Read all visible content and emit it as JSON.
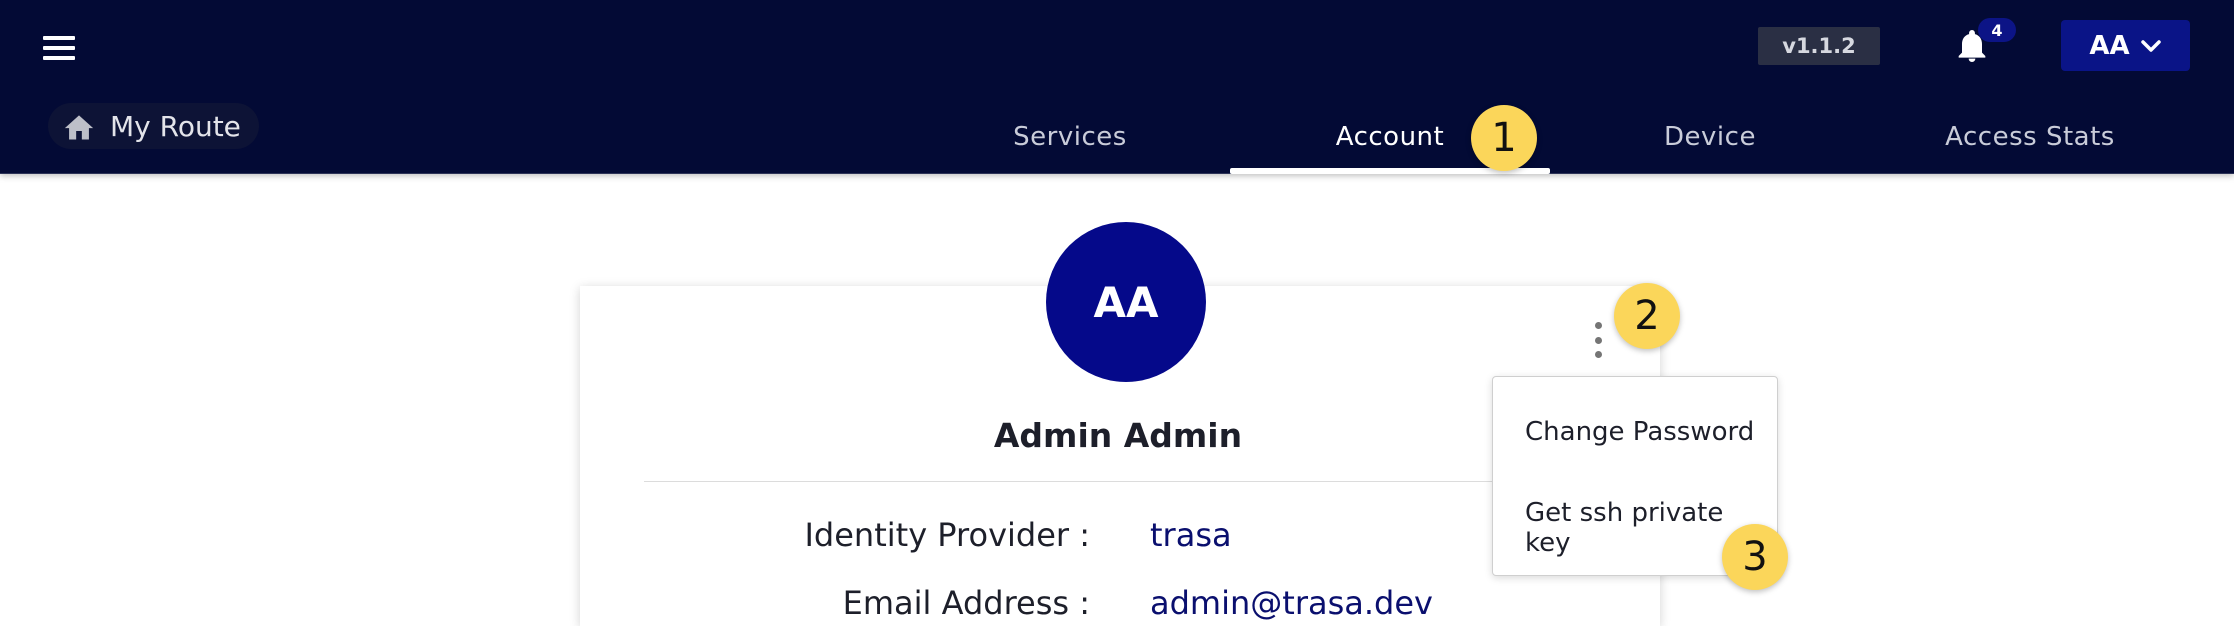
{
  "header": {
    "version": "v1.1.2",
    "notification_count": "4",
    "user_initials": "AA",
    "breadcrumb_label": "My Route"
  },
  "tabs": [
    {
      "label": "Services",
      "active": false
    },
    {
      "label": "Account",
      "active": true
    },
    {
      "label": "Device",
      "active": false
    },
    {
      "label": "Access Stats",
      "active": false
    }
  ],
  "steps": [
    "1",
    "2",
    "3"
  ],
  "profile": {
    "initials": "AA",
    "name": "Admin Admin",
    "fields": [
      {
        "label": "Identity Provider :",
        "value": "trasa"
      },
      {
        "label": "Email Address :",
        "value": "admin@trasa.dev"
      }
    ]
  },
  "menu": {
    "items": [
      "Change Password",
      "Get ssh private key"
    ]
  },
  "colors": {
    "header_bg": "#030a35",
    "accent": "#05098a",
    "step_badge": "#fbd65a"
  },
  "icons": {
    "menu": "hamburger-menu-icon",
    "notifications": "bell-icon",
    "home": "home-icon",
    "dropdown": "chevron-down-icon",
    "more": "more-vertical-icon"
  }
}
